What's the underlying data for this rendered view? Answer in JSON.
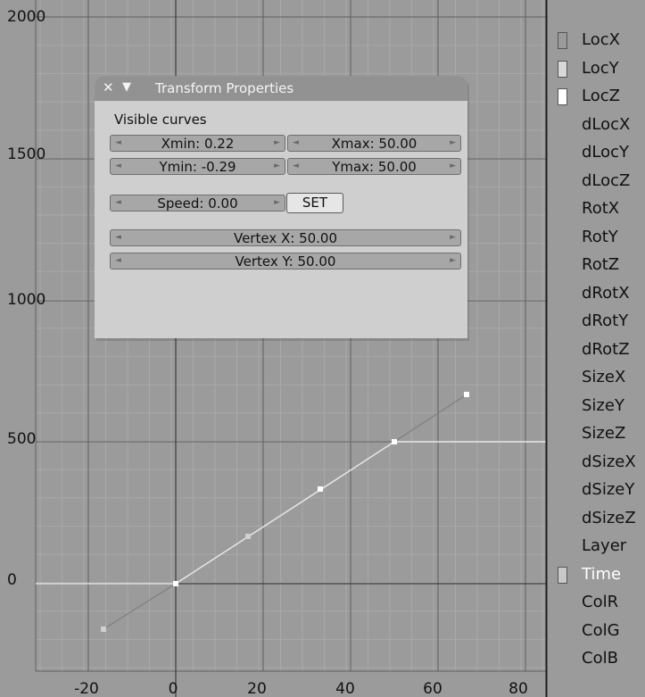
{
  "graph": {
    "y_labels": [
      "2000",
      "1500",
      "1000",
      "500",
      "0"
    ],
    "x_labels": [
      "-20",
      "0",
      "20",
      "40",
      "60",
      "80"
    ]
  },
  "transform_panel": {
    "title": "Transform Properties",
    "visible_curves": "Visible curves",
    "xmin": "Xmin: 0.22",
    "xmax": "Xmax: 50.00",
    "ymin": "Ymin: -0.29",
    "ymax": "Ymax: 50.00",
    "speed": "Speed: 0.00",
    "set": "SET",
    "vertex_x": "Vertex X: 50.00",
    "vertex_y": "Vertex Y: 50.00"
  },
  "channels": [
    {
      "label": "LocX",
      "swatch": "#9a9a9a"
    },
    {
      "label": "LocY",
      "swatch": "#d8d8d8"
    },
    {
      "label": "LocZ",
      "swatch": "#ffffff"
    },
    {
      "label": "dLocX"
    },
    {
      "label": "dLocY"
    },
    {
      "label": "dLocZ"
    },
    {
      "label": "RotX"
    },
    {
      "label": "RotY"
    },
    {
      "label": "RotZ"
    },
    {
      "label": "dRotX"
    },
    {
      "label": "dRotY"
    },
    {
      "label": "dRotZ"
    },
    {
      "label": "SizeX"
    },
    {
      "label": "SizeY"
    },
    {
      "label": "SizeZ"
    },
    {
      "label": "dSizeX"
    },
    {
      "label": "dSizeY"
    },
    {
      "label": "dSizeZ"
    },
    {
      "label": "Layer"
    },
    {
      "label": "Time",
      "swatch": "#c8c8c8",
      "selected": true
    },
    {
      "label": "ColR"
    },
    {
      "label": "ColG"
    },
    {
      "label": "ColB"
    }
  ]
}
